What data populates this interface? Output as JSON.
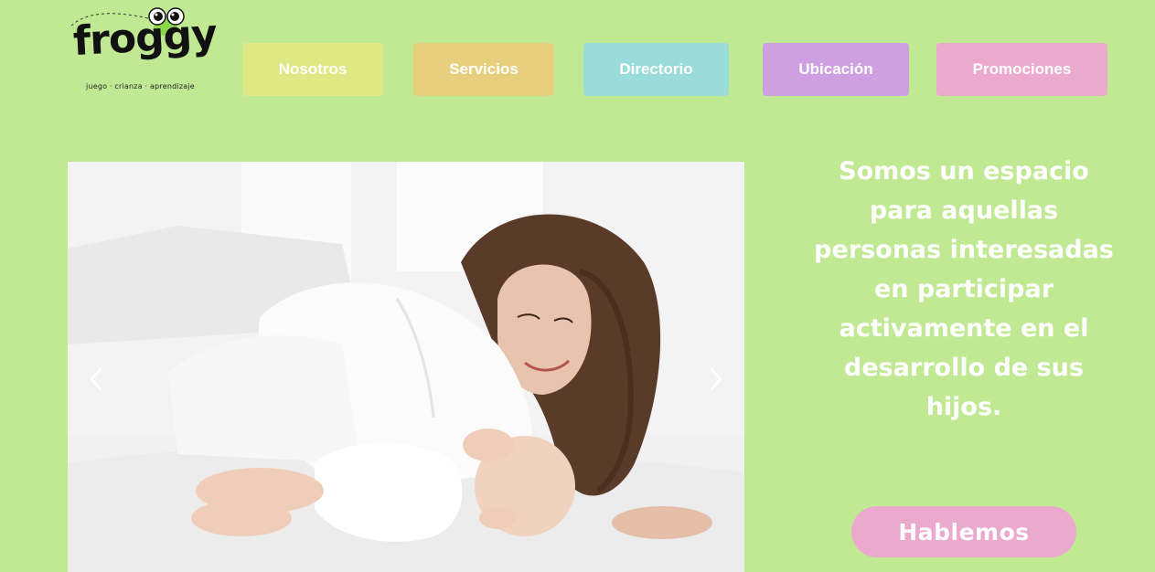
{
  "brand": {
    "name": "froggy",
    "tagline": "juego · crianza · aprendizaje"
  },
  "nav": {
    "items": [
      {
        "label": "Nosotros",
        "color": "#e0e886"
      },
      {
        "label": "Servicios",
        "color": "#e8cf7e"
      },
      {
        "label": "Directorio",
        "color": "#99dcd9"
      },
      {
        "label": "Ubicación",
        "color": "#cea0e2"
      },
      {
        "label": "Promociones",
        "color": "#eaa9cd"
      }
    ]
  },
  "hero": {
    "image_subject": "mother smiling at baby lying on white bed",
    "prev_icon": "chevron-left-icon",
    "next_icon": "chevron-right-icon",
    "headline": "Somos un espacio para aquellas personas interesadas en participar activamente en el desarrollo de sus hijos.",
    "cta_label": "Hablemos"
  },
  "colors": {
    "background": "#c1e994",
    "text_on_color": "#ffffff",
    "cta": "#eaa9cd"
  }
}
